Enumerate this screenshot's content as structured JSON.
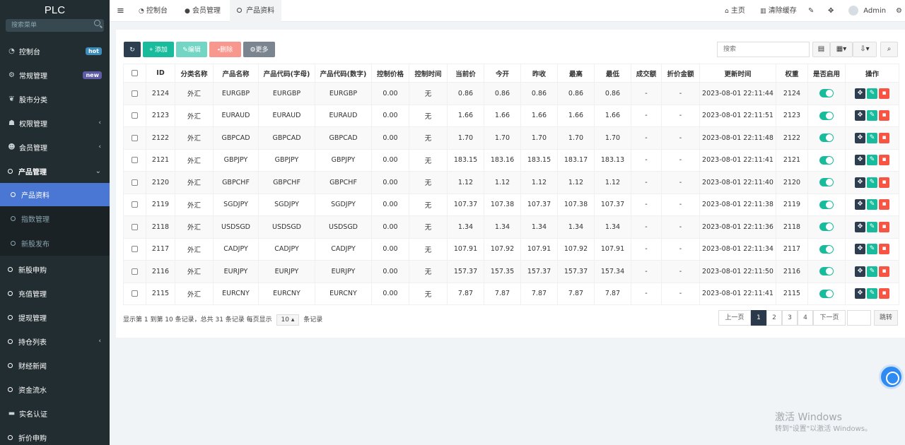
{
  "app": {
    "logo": "PLC"
  },
  "sidebar": {
    "search_placeholder": "搜索菜单",
    "items": [
      {
        "label": "控制台",
        "badge": "hot",
        "badge_color": "#3c8dbc"
      },
      {
        "label": "常规管理",
        "badge": "new",
        "badge_color": "#605ca8"
      },
      {
        "label": "股市分类"
      },
      {
        "label": "权限管理"
      },
      {
        "label": "会员管理"
      },
      {
        "label": "产品管理"
      },
      {
        "label": "产品资料"
      },
      {
        "label": "指数管理"
      },
      {
        "label": "新股发布"
      },
      {
        "label": "新股申购"
      },
      {
        "label": "充值管理"
      },
      {
        "label": "提现管理"
      },
      {
        "label": "持仓列表"
      },
      {
        "label": "财经新闻"
      },
      {
        "label": "资金流水"
      },
      {
        "label": "实名认证"
      },
      {
        "label": "折价申购"
      }
    ]
  },
  "topbar": {
    "tabs": [
      {
        "label": "控制台"
      },
      {
        "label": "会员管理"
      },
      {
        "label": "产品资料"
      }
    ],
    "home": "主页",
    "clear_cache": "清除缓存",
    "user": "Admin"
  },
  "toolbar": {
    "add": "添加",
    "edit": "编辑",
    "delete": "删除",
    "more": "更多",
    "search_placeholder": "搜索"
  },
  "table": {
    "headers": [
      "ID",
      "分类名称",
      "产品名称",
      "产品代码(字母)",
      "产品代码(数字)",
      "控制价格",
      "控制时间",
      "当前价",
      "今开",
      "昨收",
      "最高",
      "最低",
      "成交额",
      "折价金额",
      "更新时间",
      "权重",
      "是否启用",
      "操作"
    ],
    "rows": [
      [
        "2124",
        "外汇",
        "EURGBP",
        "EURGBP",
        "EURGBP",
        "0.00",
        "无",
        "0.86",
        "0.86",
        "0.86",
        "0.86",
        "0.86",
        "-",
        "-",
        "2023-08-01 22:11:44",
        "2124"
      ],
      [
        "2123",
        "外汇",
        "EURAUD",
        "EURAUD",
        "EURAUD",
        "0.00",
        "无",
        "1.66",
        "1.66",
        "1.66",
        "1.66",
        "1.66",
        "-",
        "-",
        "2023-08-01 22:11:51",
        "2123"
      ],
      [
        "2122",
        "外汇",
        "GBPCAD",
        "GBPCAD",
        "GBPCAD",
        "0.00",
        "无",
        "1.70",
        "1.70",
        "1.70",
        "1.70",
        "1.70",
        "-",
        "-",
        "2023-08-01 22:11:48",
        "2122"
      ],
      [
        "2121",
        "外汇",
        "GBPJPY",
        "GBPJPY",
        "GBPJPY",
        "0.00",
        "无",
        "183.15",
        "183.16",
        "183.15",
        "183.17",
        "183.13",
        "-",
        "-",
        "2023-08-01 22:11:41",
        "2121"
      ],
      [
        "2120",
        "外汇",
        "GBPCHF",
        "GBPCHF",
        "GBPCHF",
        "0.00",
        "无",
        "1.12",
        "1.12",
        "1.12",
        "1.12",
        "1.12",
        "-",
        "-",
        "2023-08-01 22:11:40",
        "2120"
      ],
      [
        "2119",
        "外汇",
        "SGDJPY",
        "SGDJPY",
        "SGDJPY",
        "0.00",
        "无",
        "107.37",
        "107.38",
        "107.37",
        "107.38",
        "107.37",
        "-",
        "-",
        "2023-08-01 22:11:38",
        "2119"
      ],
      [
        "2118",
        "外汇",
        "USDSGD",
        "USDSGD",
        "USDSGD",
        "0.00",
        "无",
        "1.34",
        "1.34",
        "1.34",
        "1.34",
        "1.34",
        "-",
        "-",
        "2023-08-01 22:11:36",
        "2118"
      ],
      [
        "2117",
        "外汇",
        "CADJPY",
        "CADJPY",
        "CADJPY",
        "0.00",
        "无",
        "107.91",
        "107.92",
        "107.91",
        "107.92",
        "107.91",
        "-",
        "-",
        "2023-08-01 22:11:34",
        "2117"
      ],
      [
        "2116",
        "外汇",
        "EURJPY",
        "EURJPY",
        "EURJPY",
        "0.00",
        "无",
        "157.37",
        "157.35",
        "157.37",
        "157.37",
        "157.34",
        "-",
        "-",
        "2023-08-01 22:11:50",
        "2116"
      ],
      [
        "2115",
        "外汇",
        "EURCNY",
        "EURCNY",
        "EURCNY",
        "0.00",
        "无",
        "7.87",
        "7.87",
        "7.87",
        "7.87",
        "7.87",
        "-",
        "-",
        "2023-08-01 22:11:41",
        "2115"
      ]
    ]
  },
  "footer": {
    "summary_prefix": "显示第 1 到第 10 条记录，总共 31 条记录 每页显示",
    "page_size": "10",
    "summary_suffix": "条记录",
    "prev": "上一页",
    "pages": [
      "1",
      "2",
      "3",
      "4"
    ],
    "next": "下一页",
    "goto": "跳转"
  },
  "watermark": {
    "line1": "激活 Windows",
    "line2": "转到\"设置\"以激活 Windows。"
  },
  "colors": {
    "sidebar_bg": "#222d32",
    "active_blue": "#4a77d4",
    "green": "#18bc9c",
    "dark": "#2c3e50",
    "red": "#f75444"
  }
}
